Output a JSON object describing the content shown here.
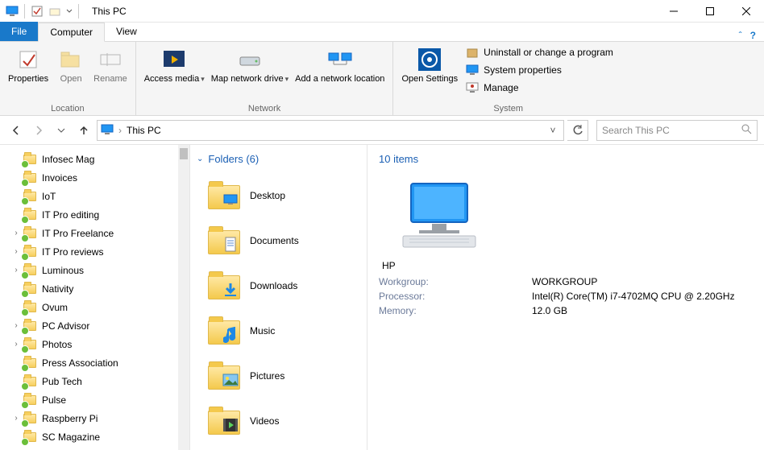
{
  "window": {
    "title": "This PC"
  },
  "tabs": {
    "file": "File",
    "computer": "Computer",
    "view": "View"
  },
  "ribbon": {
    "location": {
      "label": "Location",
      "properties": "Properties",
      "open": "Open",
      "rename": "Rename"
    },
    "network": {
      "label": "Network",
      "access_media": "Access media",
      "map_drive": "Map network drive",
      "add_location": "Add a network location"
    },
    "system": {
      "label": "System",
      "open_settings": "Open Settings",
      "uninstall": "Uninstall or change a program",
      "sys_props": "System properties",
      "manage": "Manage"
    }
  },
  "address": {
    "path": "This PC",
    "search_placeholder": "Search This PC"
  },
  "tree": [
    {
      "label": "Infosec Mag",
      "expandable": false
    },
    {
      "label": "Invoices",
      "expandable": false
    },
    {
      "label": "IoT",
      "expandable": false
    },
    {
      "label": "IT Pro editing",
      "expandable": false
    },
    {
      "label": "IT Pro Freelance",
      "expandable": true
    },
    {
      "label": "IT Pro reviews",
      "expandable": true
    },
    {
      "label": "Luminous",
      "expandable": true
    },
    {
      "label": "Nativity",
      "expandable": false
    },
    {
      "label": "Ovum",
      "expandable": false
    },
    {
      "label": "PC Advisor",
      "expandable": true
    },
    {
      "label": "Photos",
      "expandable": true
    },
    {
      "label": "Press Association",
      "expandable": false
    },
    {
      "label": "Pub Tech",
      "expandable": false
    },
    {
      "label": "Pulse",
      "expandable": false
    },
    {
      "label": "Raspberry Pi",
      "expandable": true
    },
    {
      "label": "SC Magazine",
      "expandable": false
    }
  ],
  "folders": {
    "header": "Folders (6)",
    "items": [
      "Desktop",
      "Documents",
      "Downloads",
      "Music",
      "Pictures",
      "Videos"
    ]
  },
  "details": {
    "items_header": "10 items",
    "computer_name": "HP",
    "rows": [
      {
        "k": "Workgroup:",
        "v": "WORKGROUP"
      },
      {
        "k": "Processor:",
        "v": "Intel(R) Core(TM) i7-4702MQ CPU @ 2.20GHz"
      },
      {
        "k": "Memory:",
        "v": "12.0 GB"
      }
    ]
  }
}
